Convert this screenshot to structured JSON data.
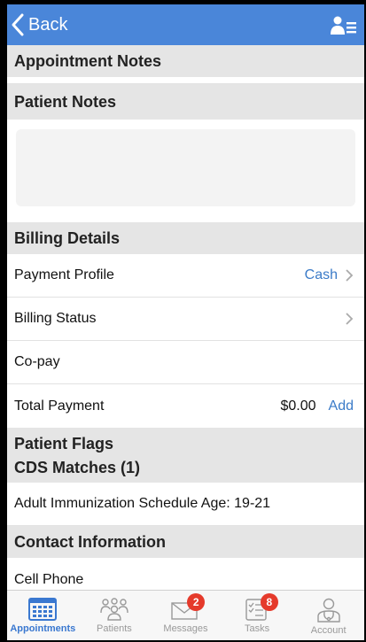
{
  "nav": {
    "back_label": "Back",
    "profile_icon": "person-list-icon"
  },
  "sections": {
    "appointment_notes": "Appointment Notes",
    "patient_notes": "Patient Notes",
    "billing_details": "Billing Details",
    "patient_flags": "Patient Flags",
    "cds_matches": "CDS Matches (1)",
    "contact_information": "Contact Information"
  },
  "billing": {
    "payment_profile": {
      "label": "Payment Profile",
      "value": "Cash"
    },
    "billing_status": {
      "label": "Billing Status"
    },
    "copay": {
      "label": "Co-pay"
    },
    "total_payment": {
      "label": "Total Payment",
      "value": "$0.00",
      "action": "Add"
    }
  },
  "cds": {
    "match_1": "Adult Immunization Schedule Age: 19-21"
  },
  "contact": {
    "cell_phone": "Cell Phone"
  },
  "tabs": [
    {
      "label": "Appointments",
      "icon": "calendar-icon",
      "active": true
    },
    {
      "label": "Patients",
      "icon": "people-icon"
    },
    {
      "label": "Messages",
      "icon": "envelope-icon",
      "badge": "2"
    },
    {
      "label": "Tasks",
      "icon": "checklist-icon",
      "badge": "8"
    },
    {
      "label": "Account",
      "icon": "account-icon"
    }
  ],
  "colors": {
    "nav": "#4a86d9",
    "link": "#3b7bc8",
    "badge": "#e53a2b",
    "section": "#e5e5e5"
  }
}
